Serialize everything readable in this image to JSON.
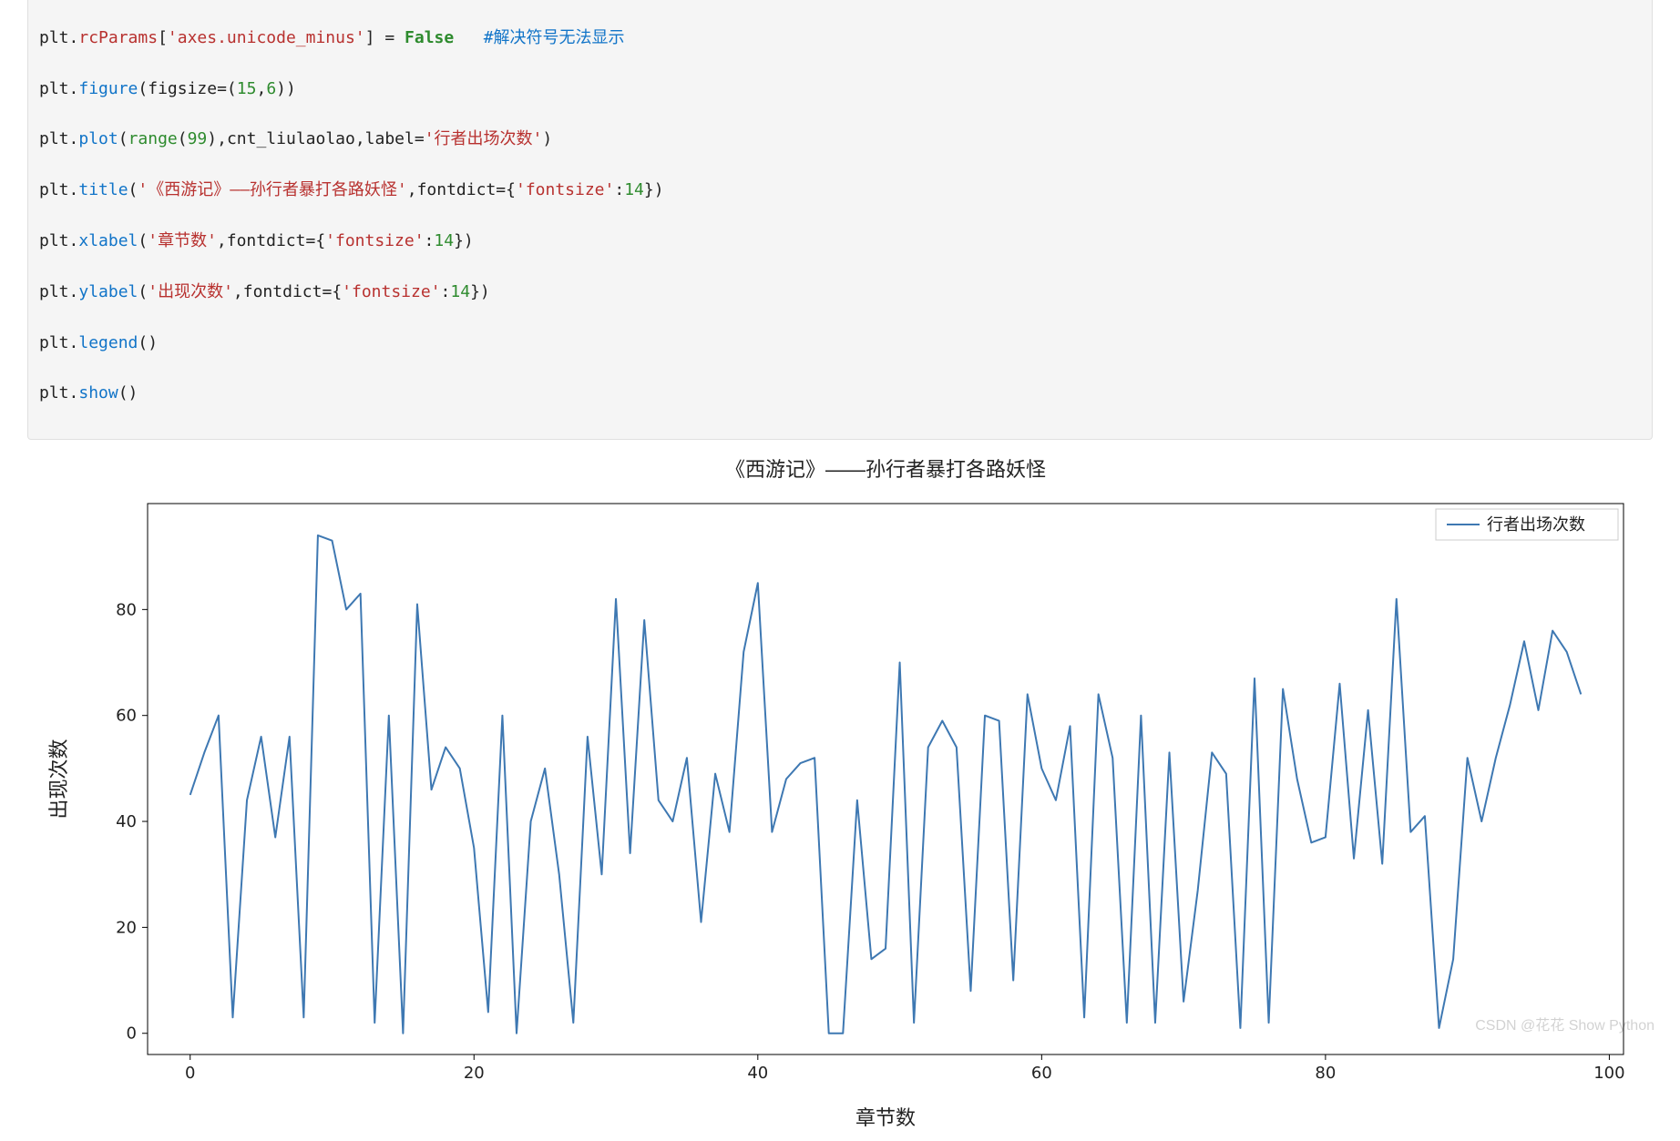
{
  "code": {
    "l1_a": "plt",
    "l1_b": ".",
    "l1_c": "rcParams",
    "l1_d": "[",
    "l1_e": "'axes.unicode_minus'",
    "l1_f": "] = ",
    "l1_g": "False",
    "l1_h": "   #解决符号无法显示",
    "l2_a": "plt",
    "l2_b": ".",
    "l2_c": "figure",
    "l2_d": "(figsize",
    "l2_e": "=(",
    "l2_f": "15",
    "l2_g": ",",
    "l2_h": "6",
    "l2_i": "))",
    "l3_a": "plt",
    "l3_b": ".",
    "l3_c": "plot",
    "l3_d": "(",
    "l3_e": "range",
    "l3_f": "(",
    "l3_g": "99",
    "l3_h": "),cnt_liulaolao,label",
    "l3_i": "=",
    "l3_j": "'行者出场次数'",
    "l3_k": ")",
    "l4_a": "plt",
    "l4_b": ".",
    "l4_c": "title",
    "l4_d": "(",
    "l4_e": "'《西游记》——孙行者暴打各路妖怪'",
    "l4_f": ",fontdict",
    "l4_g": "=",
    "l4_h": "{",
    "l4_i": "'fontsize'",
    "l4_j": ":",
    "l4_k": "14",
    "l4_l": "})",
    "l5_a": "plt",
    "l5_b": ".",
    "l5_c": "xlabel",
    "l5_d": "(",
    "l5_e": "'章节数'",
    "l5_f": ",fontdict",
    "l5_g": "=",
    "l5_h": "{",
    "l5_i": "'fontsize'",
    "l5_j": ":",
    "l5_k": "14",
    "l5_l": "})",
    "l6_a": "plt",
    "l6_b": ".",
    "l6_c": "ylabel",
    "l6_d": "(",
    "l6_e": "'出现次数'",
    "l6_f": ",fontdict",
    "l6_g": "=",
    "l6_h": "{",
    "l6_i": "'fontsize'",
    "l6_j": ":",
    "l6_k": "14",
    "l6_l": "})",
    "l7_a": "plt",
    "l7_b": ".",
    "l7_c": "legend",
    "l7_d": "()",
    "l8_a": "plt",
    "l8_b": ".",
    "l8_c": "show",
    "l8_d": "()"
  },
  "watermark": "CSDN @花花 Show Python",
  "chart_data": {
    "type": "line",
    "title": "《西游记》——孙行者暴打各路妖怪",
    "xlabel": "章节数",
    "ylabel": "出现次数",
    "series": [
      {
        "name": "行者出场次数"
      }
    ],
    "x_ticks": [
      0,
      20,
      40,
      60,
      80,
      100
    ],
    "y_ticks": [
      0,
      20,
      40,
      60,
      80
    ],
    "xlim": [
      -3,
      101
    ],
    "ylim": [
      -4,
      100
    ],
    "values": [
      45,
      53,
      60,
      3,
      44,
      56,
      37,
      56,
      3,
      94,
      93,
      80,
      83,
      2,
      60,
      0,
      81,
      46,
      54,
      50,
      35,
      4,
      60,
      0,
      40,
      50,
      30,
      2,
      56,
      30,
      82,
      34,
      78,
      44,
      40,
      52,
      21,
      49,
      38,
      72,
      85,
      38,
      48,
      51,
      52,
      0,
      0,
      44,
      14,
      16,
      70,
      2,
      54,
      59,
      54,
      8,
      60,
      59,
      10,
      64,
      50,
      44,
      58,
      3,
      64,
      52,
      2,
      60,
      2,
      53,
      6,
      27,
      53,
      49,
      1,
      67,
      2,
      65,
      48,
      36,
      37,
      66,
      33,
      61,
      32,
      82,
      38,
      41,
      1,
      14,
      52,
      40,
      52,
      62,
      74,
      61,
      76,
      72,
      64
    ]
  }
}
